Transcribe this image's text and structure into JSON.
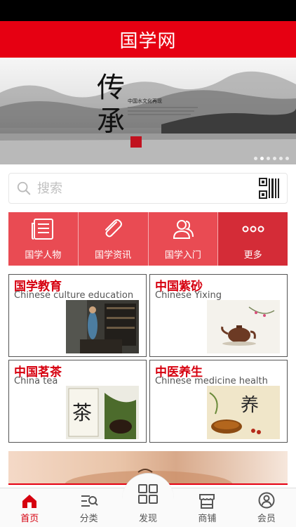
{
  "header": {
    "title": "国学网"
  },
  "banner": {
    "calligraphy": "传承",
    "subtitle": "中国水文化再现",
    "slide_count": 6,
    "active_slide": 1
  },
  "search": {
    "placeholder": "搜索"
  },
  "nav": [
    {
      "label": "国学人物",
      "icon": "newspaper-icon"
    },
    {
      "label": "国学资讯",
      "icon": "paperclip-icon"
    },
    {
      "label": "国学入门",
      "icon": "people-icon"
    },
    {
      "label": "更多",
      "icon": "more-dots-icon"
    }
  ],
  "cards": [
    {
      "title": "国学教育",
      "subtitle": "Chinese culture education"
    },
    {
      "title": "中国紫砂",
      "subtitle": "Chinese Yixing"
    },
    {
      "title": "中国茗茶",
      "subtitle": "China tea"
    },
    {
      "title": "中医养生",
      "subtitle": "Chinese medicine health"
    }
  ],
  "tabbar": [
    {
      "label": "首页",
      "icon": "home-icon",
      "active": true
    },
    {
      "label": "分类",
      "icon": "category-search-icon",
      "active": false
    },
    {
      "label": "发现",
      "icon": "discover-grid-icon",
      "active": false
    },
    {
      "label": "商铺",
      "icon": "store-icon",
      "active": false
    },
    {
      "label": "会员",
      "icon": "member-icon",
      "active": false
    }
  ],
  "colors": {
    "brand_red": "#e60012",
    "nav_red": "#e94b53",
    "nav_dark_red": "#d42c37",
    "card_title": "#d6000f"
  }
}
